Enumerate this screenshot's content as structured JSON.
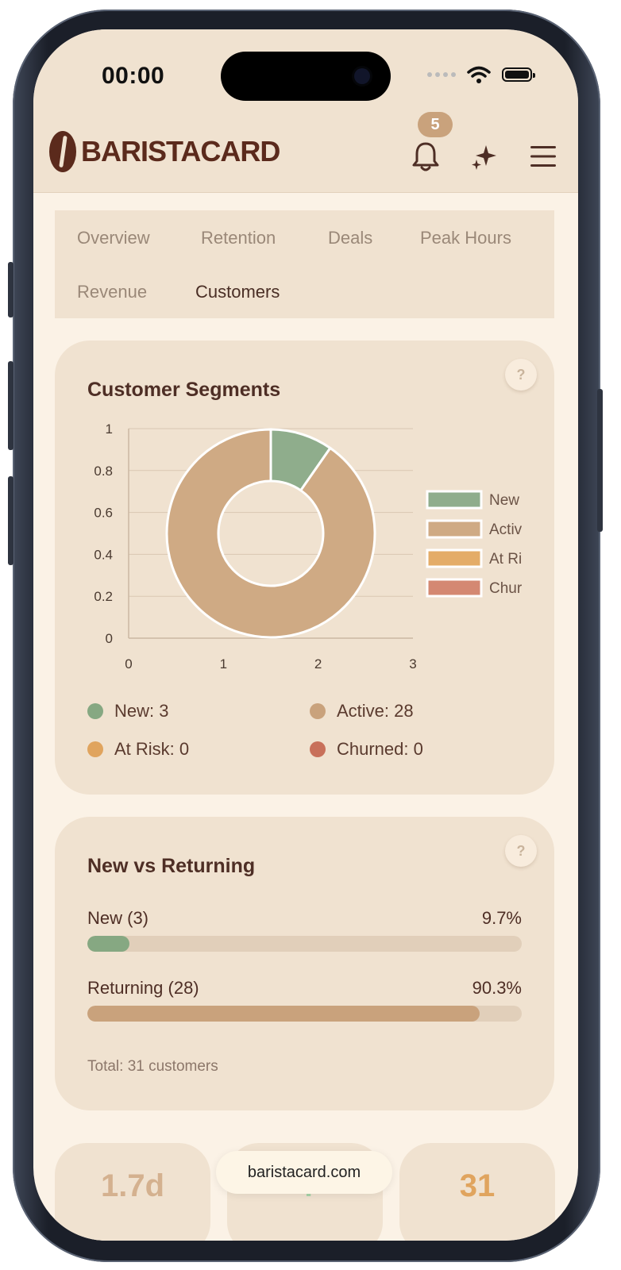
{
  "status_bar": {
    "time": "00:00"
  },
  "header": {
    "logo_text": "BARISTACARD",
    "notification_count": "5"
  },
  "tabs": [
    {
      "label": "Overview",
      "active": false
    },
    {
      "label": "Retention",
      "active": false
    },
    {
      "label": "Deals",
      "active": false
    },
    {
      "label": "Peak Hours",
      "active": false
    },
    {
      "label": "Revenue",
      "active": false
    },
    {
      "label": "Customers",
      "active": true
    }
  ],
  "segments_card": {
    "title": "Customer Segments",
    "help": "?",
    "legend_items": [
      {
        "label": "New: 3",
        "color": "#86a882"
      },
      {
        "label": "Active: 28",
        "color": "#c9a27c"
      },
      {
        "label": "At Risk: 0",
        "color": "#e0a45e"
      },
      {
        "label": "Churned: 0",
        "color": "#c8705a"
      }
    ]
  },
  "chart_data": {
    "type": "pie",
    "subtype": "doughnut",
    "labels": [
      "New",
      "Active",
      "At Risk",
      "Churned"
    ],
    "legend_display": [
      "New",
      "Activ",
      "At Ri",
      "Chur"
    ],
    "values": [
      3,
      28,
      0,
      0
    ],
    "colors": [
      "#8fad8c",
      "#cfaa84",
      "#e4ac68",
      "#d48872"
    ],
    "y_ticks": [
      "0",
      "0.2",
      "0.4",
      "0.6",
      "0.8",
      "1"
    ],
    "x_ticks": [
      "0",
      "1",
      "2",
      "3"
    ],
    "xlim": [
      0,
      3
    ],
    "ylim": [
      0,
      1
    ],
    "grid": true,
    "legend_position": "right"
  },
  "nvr_card": {
    "title": "New vs Returning",
    "help": "?",
    "rows": [
      {
        "label": "New (3)",
        "percent_text": "9.7%",
        "percent": 9.7,
        "color": "#86a882"
      },
      {
        "label": "Returning (28)",
        "percent_text": "90.3%",
        "percent": 90.3,
        "color": "#c9a27c"
      }
    ],
    "total": "Total: 31 customers"
  },
  "stats": [
    {
      "value": "1.7d",
      "color": "#d4b18f"
    },
    {
      "value": "4",
      "color": "#a7d3a8"
    },
    {
      "value": "31",
      "color": "#e0a45e"
    }
  ],
  "browser": {
    "url": "baristacard.com"
  }
}
